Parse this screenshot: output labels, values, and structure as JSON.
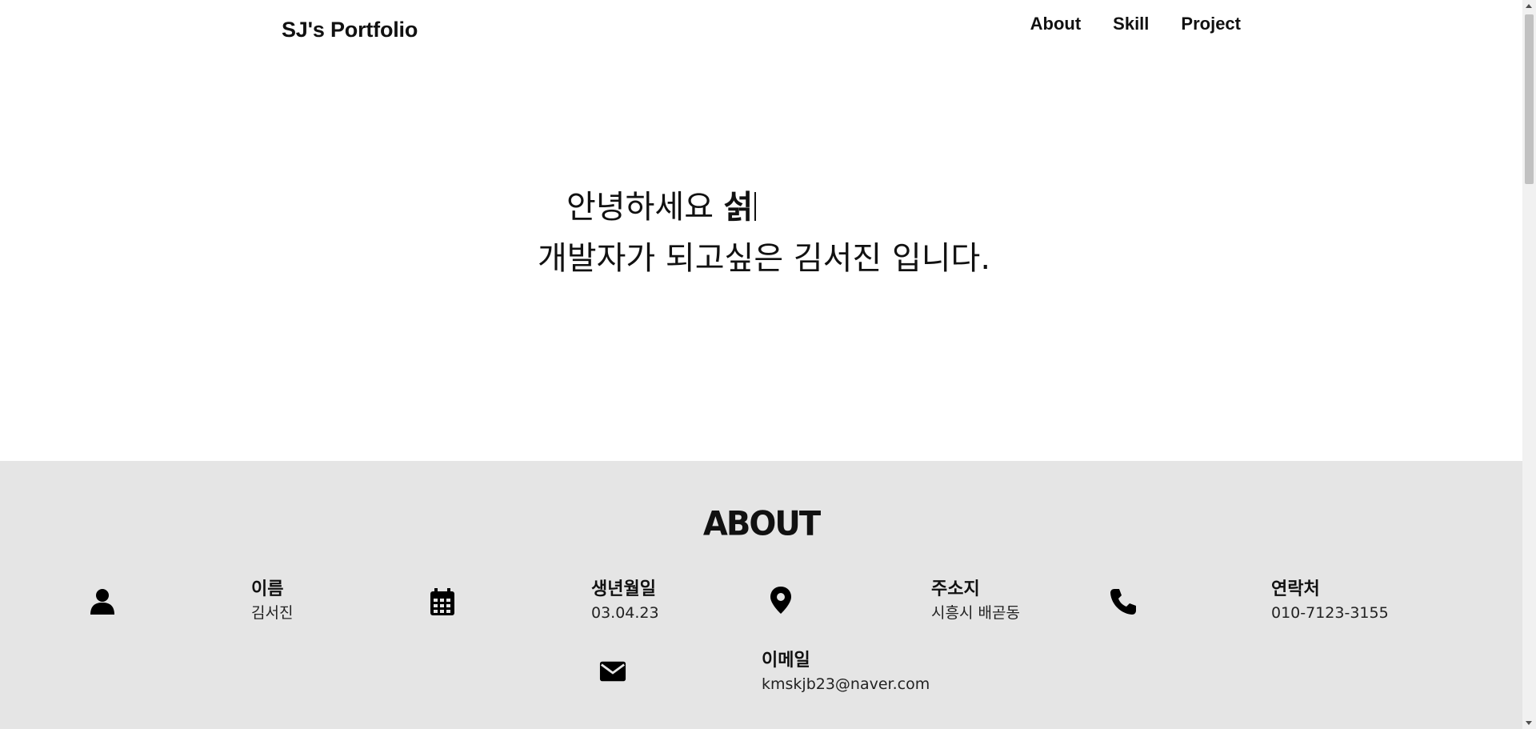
{
  "header": {
    "brand": "SJ's Portfolio",
    "nav": [
      {
        "label": "About"
      },
      {
        "label": "Skill"
      },
      {
        "label": "Project"
      }
    ]
  },
  "hero": {
    "line1_prefix": "안녕하세요 ",
    "typing_text": "섥",
    "line2": "개발자가 되고싶은 김서진 입니다."
  },
  "about": {
    "title": "ABOUT",
    "items": [
      {
        "icon": "person-icon",
        "label": "이름",
        "value": "김서진"
      },
      {
        "icon": "calendar-icon",
        "label": "생년월일",
        "value": "03.04.23"
      },
      {
        "icon": "map-pin-icon",
        "label": "주소지",
        "value": "시흥시 배곧동"
      },
      {
        "icon": "phone-icon",
        "label": "연락처",
        "value": "010-7123-3155"
      },
      {
        "icon": "envelope-icon",
        "label": "이메일",
        "value": "kmskjb23@naver.com"
      }
    ]
  },
  "colors": {
    "text": "#111111",
    "about_background": "#e5e5e5",
    "page_background": "#ffffff"
  }
}
